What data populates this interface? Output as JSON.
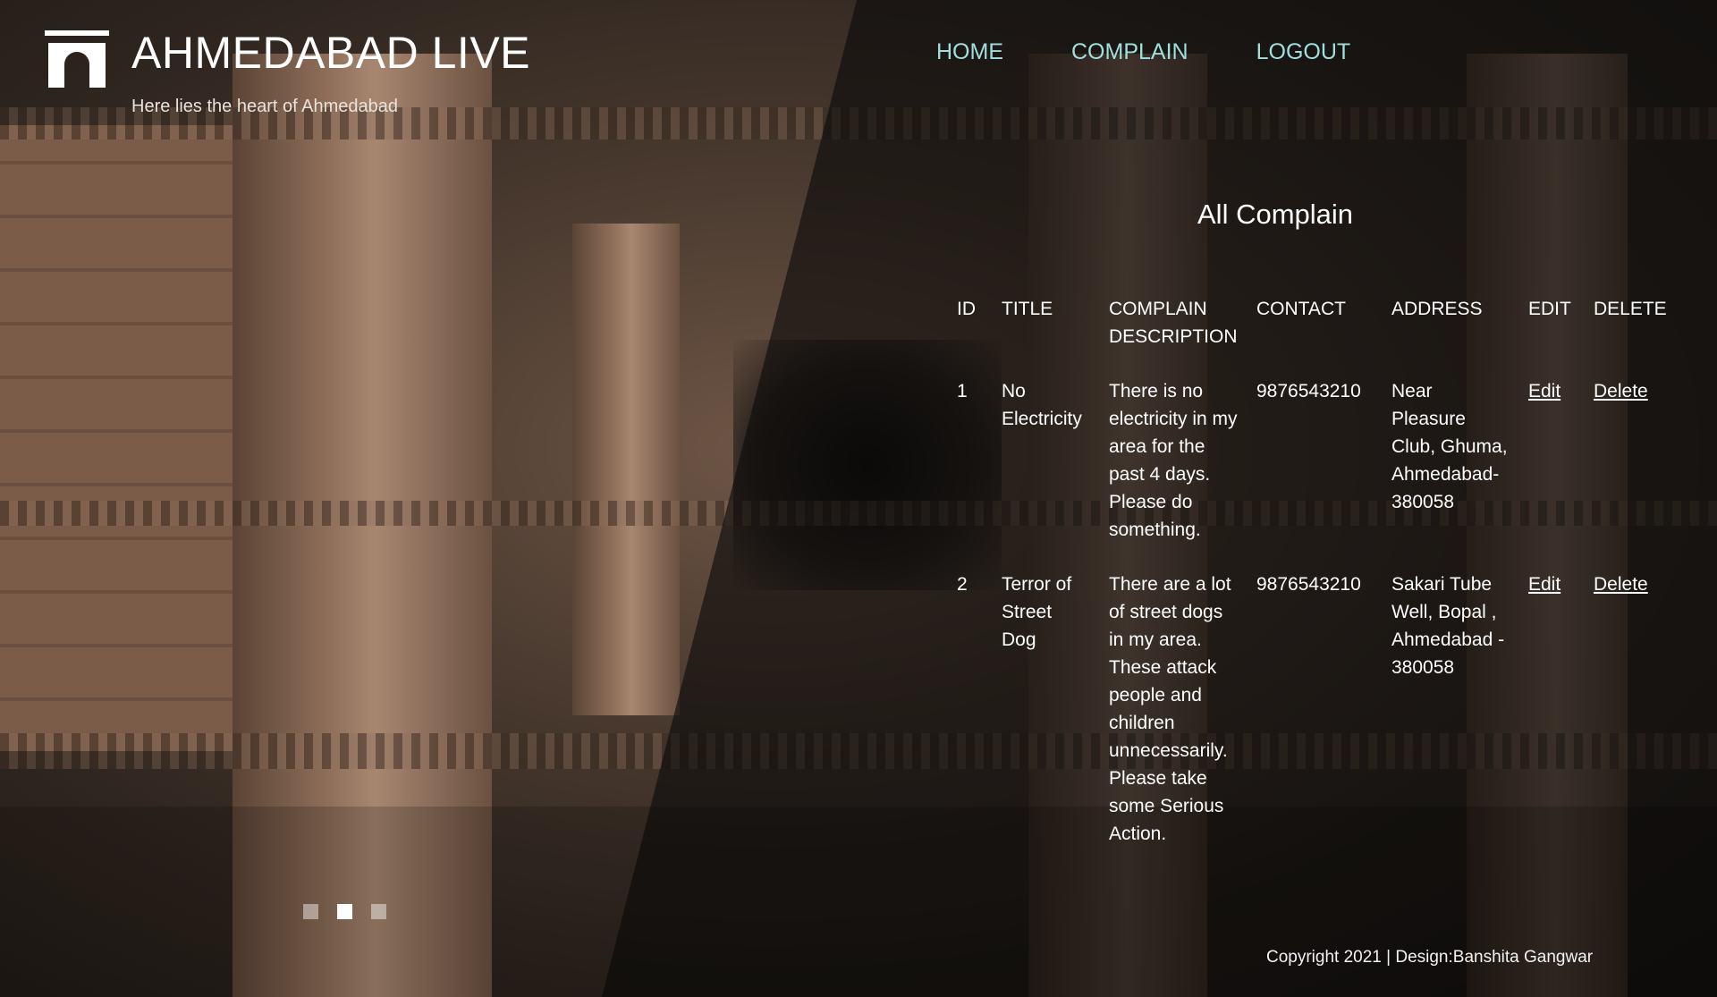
{
  "header": {
    "logo_icon": "gateway-arch-icon",
    "title": "AHMEDABAD LIVE",
    "tagline": "Here lies the heart of Ahmedabad"
  },
  "nav": {
    "items": [
      {
        "label": "HOME"
      },
      {
        "label": "COMPLAIN"
      },
      {
        "label": "LOGOUT"
      }
    ],
    "link_color": "#9fe0dc"
  },
  "main": {
    "title": "All Complain",
    "table": {
      "headers": {
        "id": "ID",
        "title": "TITLE",
        "description": "COMPLAIN DESCRIPTION",
        "contact": "CONTACT",
        "address": "ADDRESS",
        "edit": "EDIT",
        "delete": "DELETE"
      },
      "rows": [
        {
          "id": "1",
          "title": "No Electricity",
          "description": "There is no electricity in my area for the past 4 days. Please do something.",
          "contact": "9876543210",
          "address": "Near Pleasure Club, Ghuma, Ahmedabad-380058",
          "edit": "Edit",
          "delete": "Delete"
        },
        {
          "id": "2",
          "title": "Terror of Street Dog",
          "description": "There are a lot of street dogs in my area. These attack people and children unnecessarily. Please take some Serious Action.",
          "contact": "9876543210",
          "address": "Sakari Tube Well, Bopal , Ahmedabad - 380058",
          "edit": "Edit",
          "delete": "Delete"
        }
      ]
    }
  },
  "slider": {
    "dot_count": 3,
    "active_index": 1
  },
  "footer": {
    "text": "Copyright 2021 | Design:Banshita Gangwar"
  }
}
